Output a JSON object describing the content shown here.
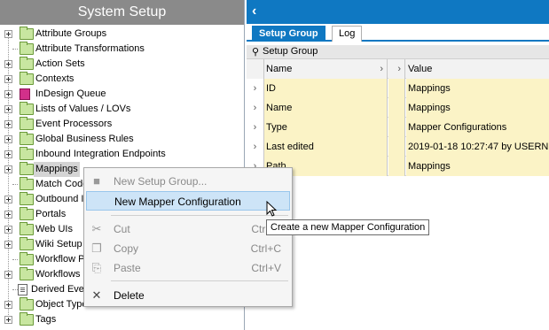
{
  "left_panel": {
    "title": "System Setup",
    "tree_items": [
      {
        "label": "Attribute Groups",
        "icon": "folder-icon",
        "expandable": true
      },
      {
        "label": "Attribute Transformations",
        "icon": "folder-icon",
        "expandable": false
      },
      {
        "label": "Action Sets",
        "icon": "folder-icon",
        "expandable": true
      },
      {
        "label": "Contexts",
        "icon": "folder-icon",
        "expandable": true
      },
      {
        "label": "InDesign Queue",
        "icon": "indesign-icon",
        "expandable": true
      },
      {
        "label": "Lists of Values / LOVs",
        "icon": "folder-icon",
        "expandable": true
      },
      {
        "label": "Event Processors",
        "icon": "folder-icon",
        "expandable": true
      },
      {
        "label": "Global Business Rules",
        "icon": "folder-icon",
        "expandable": true
      },
      {
        "label": "Inbound Integration Endpoints",
        "icon": "folder-icon",
        "expandable": true
      },
      {
        "label": "Mappings",
        "icon": "folder-icon",
        "expandable": true
      },
      {
        "label": "Match Code",
        "icon": "folder-icon",
        "expandable": false
      },
      {
        "label": "Outbound I",
        "icon": "folder-icon",
        "expandable": true
      },
      {
        "label": "Portals",
        "icon": "folder-icon",
        "expandable": true
      },
      {
        "label": "Web UIs",
        "icon": "folder-icon",
        "expandable": true
      },
      {
        "label": "Wiki Setup",
        "icon": "folder-icon",
        "expandable": true
      },
      {
        "label": "Workflow P",
        "icon": "folder-icon",
        "expandable": false
      },
      {
        "label": "Workflows",
        "icon": "folder-icon",
        "expandable": true
      },
      {
        "label": "Derived Eve",
        "icon": "document-icon",
        "expandable": false
      },
      {
        "label": "Object Types & Structures",
        "icon": "folder-icon",
        "expandable": true
      },
      {
        "label": "Tags",
        "icon": "folder-icon",
        "expandable": true
      }
    ]
  },
  "right_panel": {
    "back_icon": "chevron-left-icon",
    "tabs": [
      {
        "label": "Setup Group",
        "active": true
      },
      {
        "label": "Log",
        "active": false
      }
    ],
    "grid_title": "Setup Group",
    "columns": {
      "name": "Name",
      "value": "Value"
    },
    "rows": [
      {
        "name": "ID",
        "value": "Mappings"
      },
      {
        "name": "Name",
        "value": "Mappings"
      },
      {
        "name": "Type",
        "value": "Mapper Configurations"
      },
      {
        "name": "Last edited",
        "value": "2019-01-18 10:27:47 by USERN"
      },
      {
        "name": "Path",
        "value": "Mappings"
      }
    ]
  },
  "context_menu": {
    "new_setup_group": "New Setup Group...",
    "new_mapper_configuration": "New Mapper Configuration",
    "cut": "Cut",
    "cut_shortcut": "Ctrl+X",
    "copy": "Copy",
    "copy_shortcut": "Ctrl+C",
    "paste": "Paste",
    "paste_shortcut": "Ctrl+V",
    "delete": "Delete"
  },
  "tooltip": "Create a new Mapper Configuration",
  "colors": {
    "accent": "#0f78c2",
    "header_gray": "#8a8a8a",
    "row_highlight": "#fbf3c6",
    "menu_highlight": "#cde4f7"
  }
}
